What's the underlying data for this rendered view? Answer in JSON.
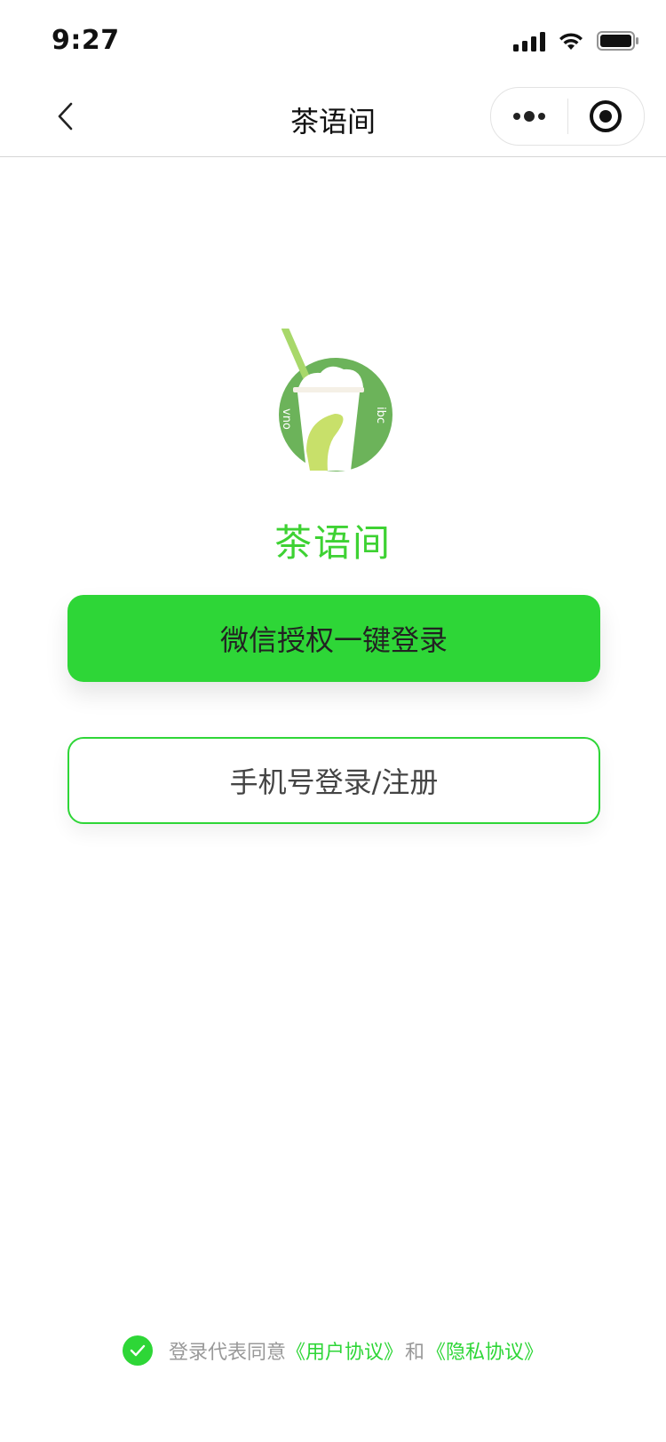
{
  "status_bar": {
    "time": "9:27"
  },
  "nav": {
    "title": "茶语间"
  },
  "logo": {
    "left_text": "vno",
    "right_text": "ibc",
    "colors": {
      "circle": "#6cb35a",
      "straw": "#a8d86a",
      "cup": "#ffffff",
      "lid": "#f5f0e6",
      "splash": "#c8e06a"
    }
  },
  "app_name": "茶语间",
  "buttons": {
    "wechat_login": "微信授权一键登录",
    "phone_login": "手机号登录/注册"
  },
  "agreement": {
    "prefix": "登录代表同意",
    "user_agreement": "《用户协议》",
    "conjunction": "和",
    "privacy_policy": "《隐私协议》"
  },
  "colors": {
    "accent": "#2ed637",
    "title_green": "#3ed233"
  }
}
